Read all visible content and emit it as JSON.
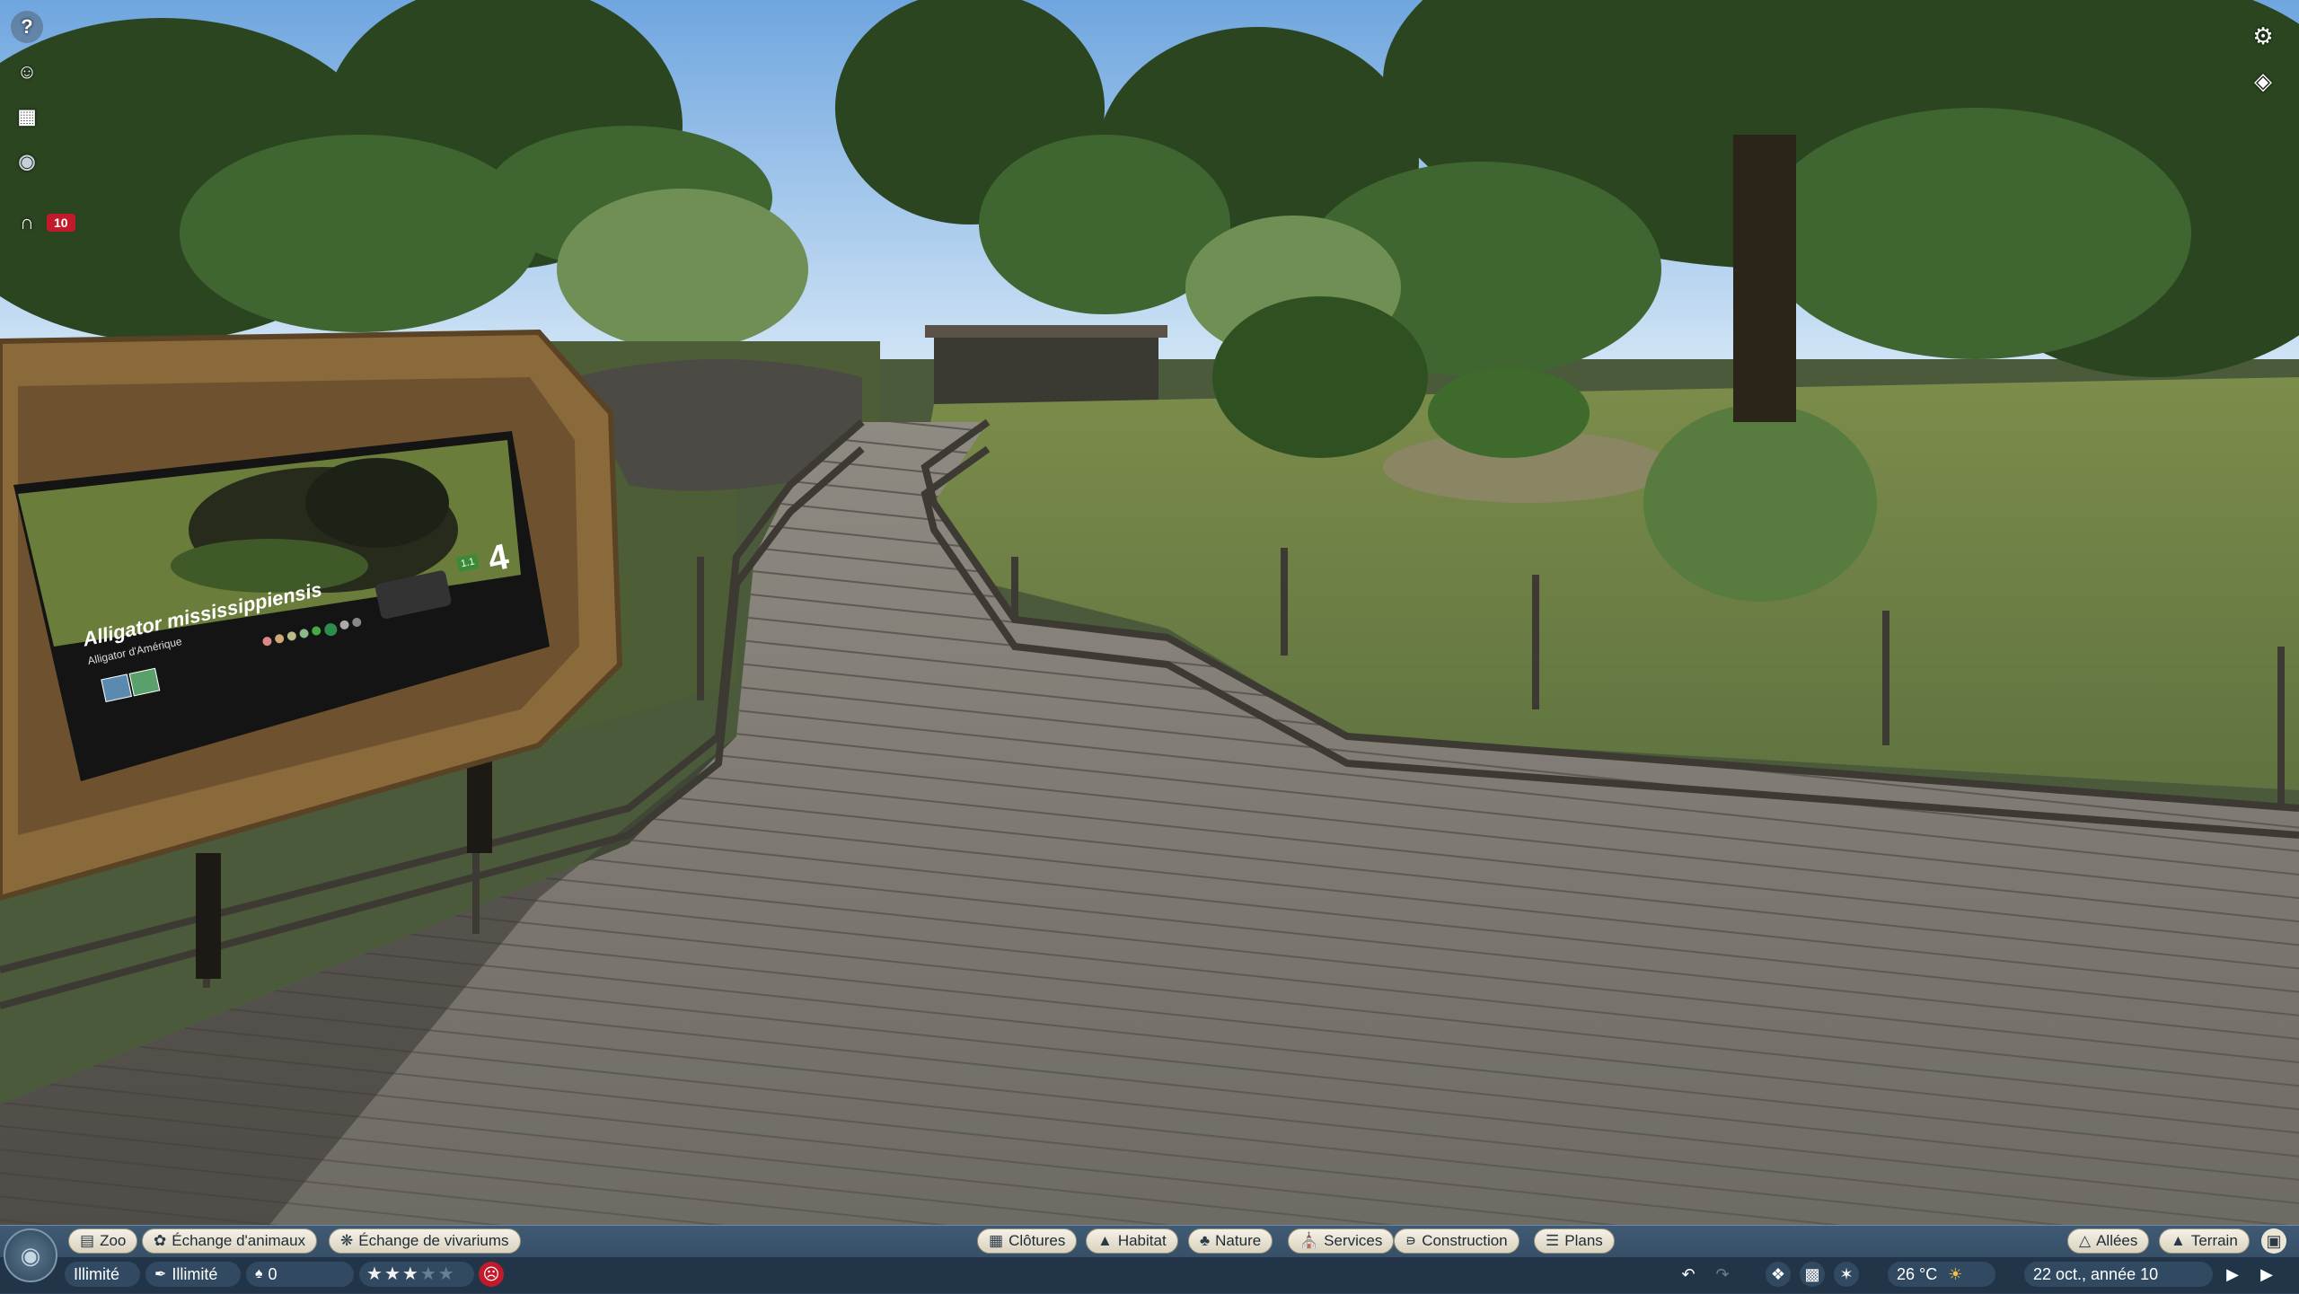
{
  "sign": {
    "species_name": "Alligator mississippiensis",
    "common_name": "Alligator d'Amérique",
    "conservation_count": "4",
    "region_code": "1.1"
  },
  "left_toolbar": {
    "help": "help-icon",
    "guests": "guest-portrait-icon",
    "calendar": "calendar-icon",
    "view": "eye-icon",
    "entrance": "zoo-entrance-icon",
    "notification_count": "10"
  },
  "right_toolbar": {
    "settings": "gear-icon",
    "overlay": "globe-overlay-icon"
  },
  "bottom_menu": {
    "left_buttons": [
      {
        "label": "Zoo",
        "icon": "zoo-icon"
      },
      {
        "label": "Échange d'animaux",
        "icon": "paw-icon"
      },
      {
        "label": "Échange de vivariums",
        "icon": "vivarium-icon"
      }
    ],
    "center_buttons": [
      {
        "label": "Clôtures",
        "icon": "fence-icon"
      },
      {
        "label": "Habitat",
        "icon": "habitat-icon"
      },
      {
        "label": "Nature",
        "icon": "tree-icon"
      },
      {
        "label": "Services",
        "icon": "services-icon"
      },
      {
        "label": "Construction",
        "icon": "construction-icon"
      },
      {
        "label": "Plans",
        "icon": "plans-icon"
      }
    ],
    "right_buttons": [
      {
        "label": "Allées",
        "icon": "path-icon"
      },
      {
        "label": "Terrain",
        "icon": "terrain-icon"
      }
    ]
  },
  "status_bar": {
    "money": "Illimité",
    "research": "Illimité",
    "guests_count": "0",
    "zoo_rating_stars": 3,
    "zoo_rating_max": 5,
    "temperature": "26 °C",
    "weather": "sunny-icon",
    "date": "22 oct., année 10"
  },
  "colors": {
    "ui_bar": "#2d4459",
    "button_face": "#ece6d6",
    "alert_red": "#c21a2b",
    "star_gold": "#f2f2f2"
  }
}
